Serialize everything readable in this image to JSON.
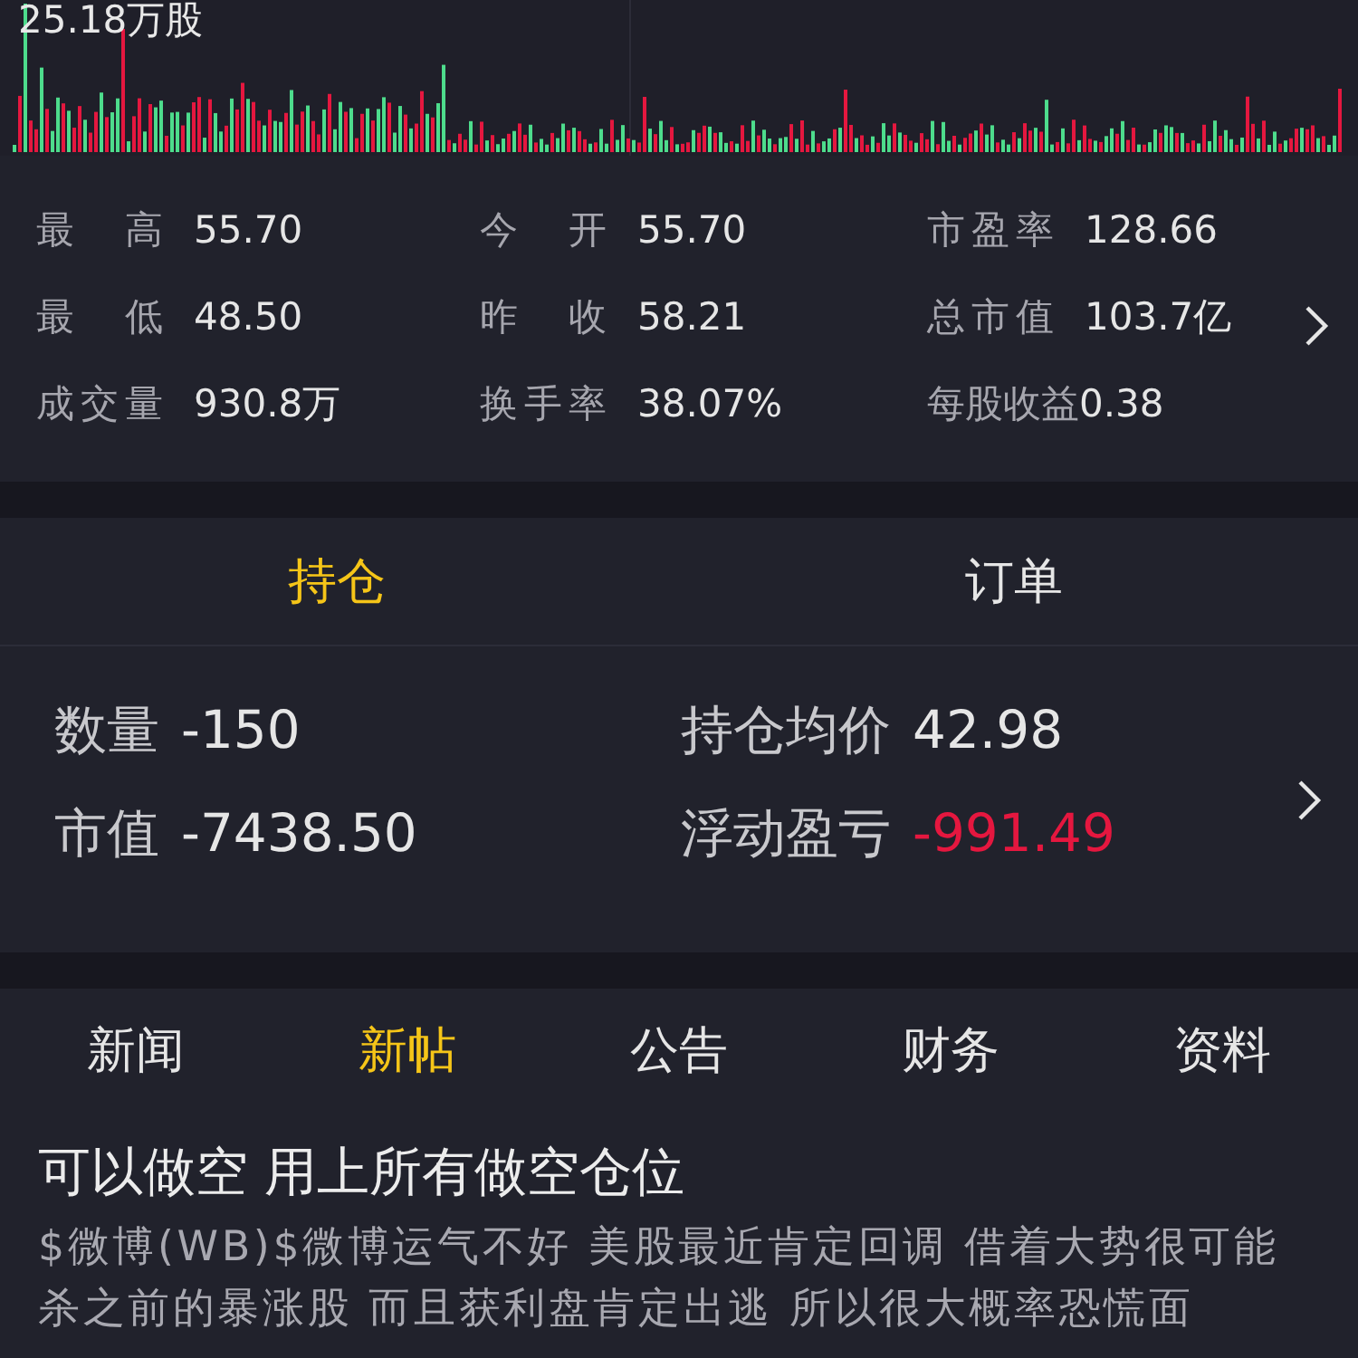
{
  "volume_label": "25.18万股",
  "stats": [
    {
      "label": "最高",
      "value": "55.70"
    },
    {
      "label": "今开",
      "value": "55.70"
    },
    {
      "label": "市盈率",
      "value": "128.66"
    },
    {
      "label": "最低",
      "value": "48.50"
    },
    {
      "label": "昨收",
      "value": "58.21"
    },
    {
      "label": "总市值",
      "value": "103.7亿"
    },
    {
      "label": "成交量",
      "value": "930.8万"
    },
    {
      "label": "换手率",
      "value": "38.07%"
    },
    {
      "label": "每股收益",
      "value": "0.38"
    }
  ],
  "position_tabs": [
    {
      "label": "持仓",
      "selected": true
    },
    {
      "label": "订单",
      "selected": false
    }
  ],
  "position": [
    {
      "label": "数量",
      "value": "-150",
      "kind": "plain"
    },
    {
      "label": "持仓均价",
      "value": "42.98",
      "kind": "plain"
    },
    {
      "label": "市值",
      "value": "-7438.50",
      "kind": "plain"
    },
    {
      "label": "浮动盈亏",
      "value": "-991.49",
      "kind": "loss"
    }
  ],
  "news_tabs": [
    {
      "label": "新闻",
      "selected": false
    },
    {
      "label": "新帖",
      "selected": true
    },
    {
      "label": "公告",
      "selected": false
    },
    {
      "label": "财务",
      "selected": false
    },
    {
      "label": "资料",
      "selected": false
    }
  ],
  "post": {
    "title": "可以做空 用上所有做空仓位",
    "body": "$微博(WB)$微博运气不好 美股最近肯定回调 借着大势很可能杀之前的暴涨股 而且获利盘肯定出逃 所以很大概率恐慌面"
  }
}
